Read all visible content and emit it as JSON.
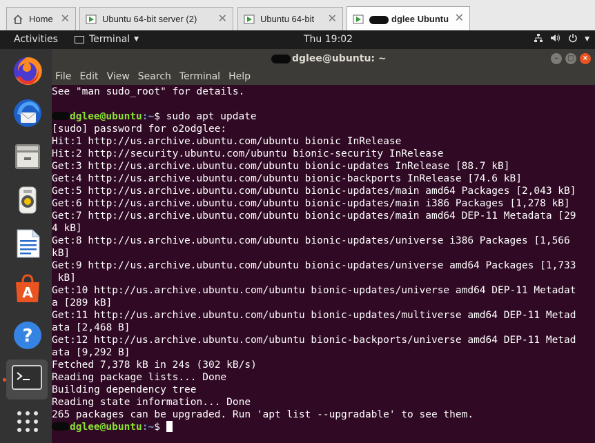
{
  "vm_tabs": [
    {
      "label": "Home",
      "icon": "home-icon",
      "active": false
    },
    {
      "label": "Ubuntu 64-bit server (2)",
      "icon": "vm-icon",
      "active": false
    },
    {
      "label": "Ubuntu 64-bit",
      "icon": "vm-icon",
      "active": false
    },
    {
      "label": "dglee Ubuntu",
      "icon": "vm-icon",
      "active": true
    }
  ],
  "tab_close_glyph": "✕",
  "topbar": {
    "activities": "Activities",
    "app_menu": "Terminal",
    "clock": "Thu 19:02"
  },
  "dock": [
    {
      "name": "firefox-icon"
    },
    {
      "name": "thunderbird-icon"
    },
    {
      "name": "files-icon"
    },
    {
      "name": "rhythmbox-icon"
    },
    {
      "name": "libreoffice-writer-icon"
    },
    {
      "name": "software-center-icon"
    },
    {
      "name": "help-icon"
    },
    {
      "name": "terminal-icon",
      "active": true
    },
    {
      "name": "show-applications-icon"
    }
  ],
  "terminal": {
    "title": "dglee@ubuntu: ~",
    "menu": [
      "File",
      "Edit",
      "View",
      "Search",
      "Terminal",
      "Help"
    ],
    "prompt_user": "dglee@ubuntu",
    "prompt_path": ":~",
    "prompt_symbol": "$ ",
    "command": "sudo apt update",
    "lines_before": [
      "See \"man sudo_root\" for details."
    ],
    "output": [
      "[sudo] password for o2odglee:",
      "Hit:1 http://us.archive.ubuntu.com/ubuntu bionic InRelease",
      "Hit:2 http://security.ubuntu.com/ubuntu bionic-security InRelease",
      "Get:3 http://us.archive.ubuntu.com/ubuntu bionic-updates InRelease [88.7 kB]",
      "Get:4 http://us.archive.ubuntu.com/ubuntu bionic-backports InRelease [74.6 kB]",
      "Get:5 http://us.archive.ubuntu.com/ubuntu bionic-updates/main amd64 Packages [2,043 kB]",
      "Get:6 http://us.archive.ubuntu.com/ubuntu bionic-updates/main i386 Packages [1,278 kB]",
      "Get:7 http://us.archive.ubuntu.com/ubuntu bionic-updates/main amd64 DEP-11 Metadata [29",
      "4 kB]",
      "Get:8 http://us.archive.ubuntu.com/ubuntu bionic-updates/universe i386 Packages [1,566",
      "kB]",
      "Get:9 http://us.archive.ubuntu.com/ubuntu bionic-updates/universe amd64 Packages [1,733",
      " kB]",
      "Get:10 http://us.archive.ubuntu.com/ubuntu bionic-updates/universe amd64 DEP-11 Metadat",
      "a [289 kB]",
      "Get:11 http://us.archive.ubuntu.com/ubuntu bionic-updates/multiverse amd64 DEP-11 Metad",
      "ata [2,468 B]",
      "Get:12 http://us.archive.ubuntu.com/ubuntu bionic-backports/universe amd64 DEP-11 Metad",
      "ata [9,292 B]",
      "Fetched 7,378 kB in 24s (302 kB/s)",
      "Reading package lists... Done",
      "Building dependency tree",
      "Reading state information... Done",
      "265 packages can be upgraded. Run 'apt list --upgradable' to see them."
    ]
  },
  "colors": {
    "terminal_bg": "#300a24",
    "prompt_user": "#8ae234",
    "prompt_path": "#729fcf",
    "accent": "#e95420"
  }
}
